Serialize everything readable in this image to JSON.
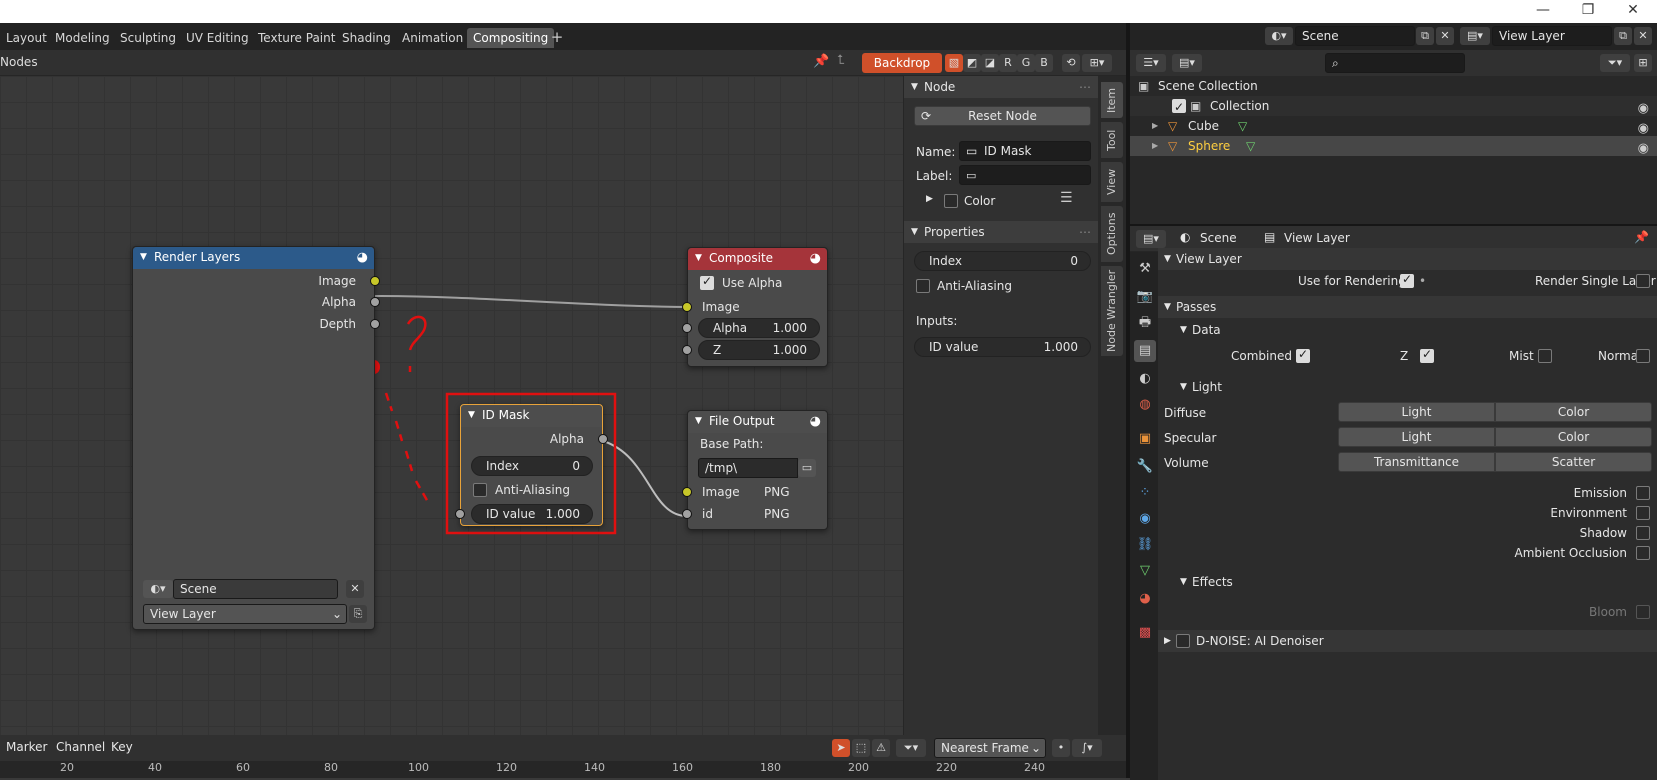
{
  "workspaces": [
    "Layout",
    "Modeling",
    "Sculpting",
    "UV Editing",
    "Texture Paint",
    "Shading",
    "Animation",
    "Compositing"
  ],
  "active_workspace": "Compositing",
  "scene_name": "Scene",
  "view_layer_name": "View Layer",
  "node_editor": {
    "header_label": "Nodes",
    "backdrop_label": "Backdrop",
    "channel_buttons": [
      "R",
      "G",
      "B"
    ]
  },
  "nodes": {
    "render_layers": {
      "title": "Render Layers",
      "outputs": [
        "Image",
        "Alpha",
        "Depth"
      ],
      "scene": "Scene",
      "view_layer": "View Layer"
    },
    "composite": {
      "title": "Composite",
      "use_alpha_label": "Use Alpha",
      "use_alpha": true,
      "image_label": "Image",
      "alpha_label": "Alpha",
      "alpha_value": "1.000",
      "z_label": "Z",
      "z_value": "1.000"
    },
    "id_mask": {
      "title": "ID Mask",
      "alpha_label": "Alpha",
      "index_label": "Index",
      "index_value": "0",
      "anti_alias_label": "Anti-Aliasing",
      "id_value_label": "ID value",
      "id_value": "1.000"
    },
    "file_output": {
      "title": "File Output",
      "base_path_label": "Base Path:",
      "base_path": "/tmp\\",
      "image_label": "Image",
      "image_format": "PNG",
      "id_label": "id",
      "id_format": "PNG"
    }
  },
  "npanel": {
    "node_header": "Node",
    "reset_node": "Reset Node",
    "name_label": "Name:",
    "name_value": "ID Mask",
    "label_label": "Label:",
    "color_label": "Color",
    "properties_header": "Properties",
    "index_label": "Index",
    "index_value": "0",
    "anti_alias_label": "Anti-Aliasing",
    "inputs_label": "Inputs:",
    "id_value_label": "ID value",
    "id_value": "1.000",
    "tabs": [
      "Item",
      "Tool",
      "View",
      "Options",
      "Node Wrangler"
    ]
  },
  "timeline": {
    "menus": [
      "Marker",
      "Channel",
      "Key"
    ],
    "snap_mode": "Nearest Frame",
    "ruler": [
      "20",
      "40",
      "60",
      "80",
      "100",
      "120",
      "140",
      "160",
      "180",
      "200",
      "220",
      "240"
    ]
  },
  "outliner": {
    "rows": [
      {
        "label": "Scene Collection"
      },
      {
        "label": "Collection"
      },
      {
        "label": "Cube"
      },
      {
        "label": "Sphere"
      }
    ]
  },
  "properties": {
    "view_layer_header": "View Layer",
    "use_for_rendering": "Use for Rendering",
    "render_single_layer": "Render Single Layer",
    "passes_header": "Passes",
    "data_header": "Data",
    "combined": "Combined",
    "z": "Z",
    "mist": "Mist",
    "normal": "Normal",
    "light_header": "Light",
    "diffuse": "Diffuse",
    "specular": "Specular",
    "volume": "Volume",
    "light_btn": "Light",
    "color_btn": "Color",
    "transmittance": "Transmittance",
    "scatter": "Scatter",
    "emission": "Emission",
    "environment": "Environment",
    "shadow": "Shadow",
    "ambient_occlusion": "Ambient Occlusion",
    "effects_header": "Effects",
    "bloom": "Bloom",
    "dnoise": "D-NOISE: AI Denoiser"
  },
  "colors": {
    "render_layers_header": "#2c5a8a",
    "composite_header": "#a5343a",
    "file_output_header": "#4d4d4d",
    "selection": "#e8a33a",
    "annotation": "#e01010",
    "backdrop_btn": "#d0502a"
  }
}
